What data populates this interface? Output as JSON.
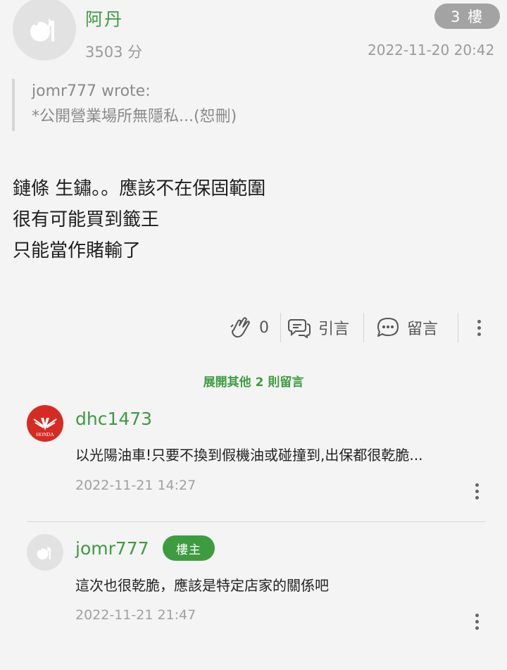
{
  "post": {
    "author": "阿丹",
    "score": "3503 分",
    "floor": "3 樓",
    "time": "2022-11-20 20:42",
    "quote": {
      "attribution": "jomr777 wrote:",
      "text": "*公開營業場所無隱私...(恕刪)"
    },
    "body_lines": [
      "鏈條 生鏽。。應該不在保固範圍",
      "很有可能買到籤王",
      "只能當作賭輸了"
    ]
  },
  "actions": {
    "like_count": "0",
    "quote_label": "引言",
    "comment_label": "留言"
  },
  "expand_label": "展開其他 2 則留言",
  "comments": [
    {
      "user": "dhc1473",
      "text": "以光陽油車!只要不換到假機油或碰撞到,出保都很乾脆...",
      "time": "2022-11-21 14:27",
      "avatar_logo": "HONDA"
    },
    {
      "user": "jomr777",
      "badge": "樓主",
      "text": "這次也很乾脆，應該是特定店家的關係吧",
      "time": "2022-11-21 21:47"
    }
  ],
  "colors": {
    "accent_green": "#3d9c3f",
    "badge_grey": "#a3a3a3",
    "honda_red": "#d62b22"
  }
}
